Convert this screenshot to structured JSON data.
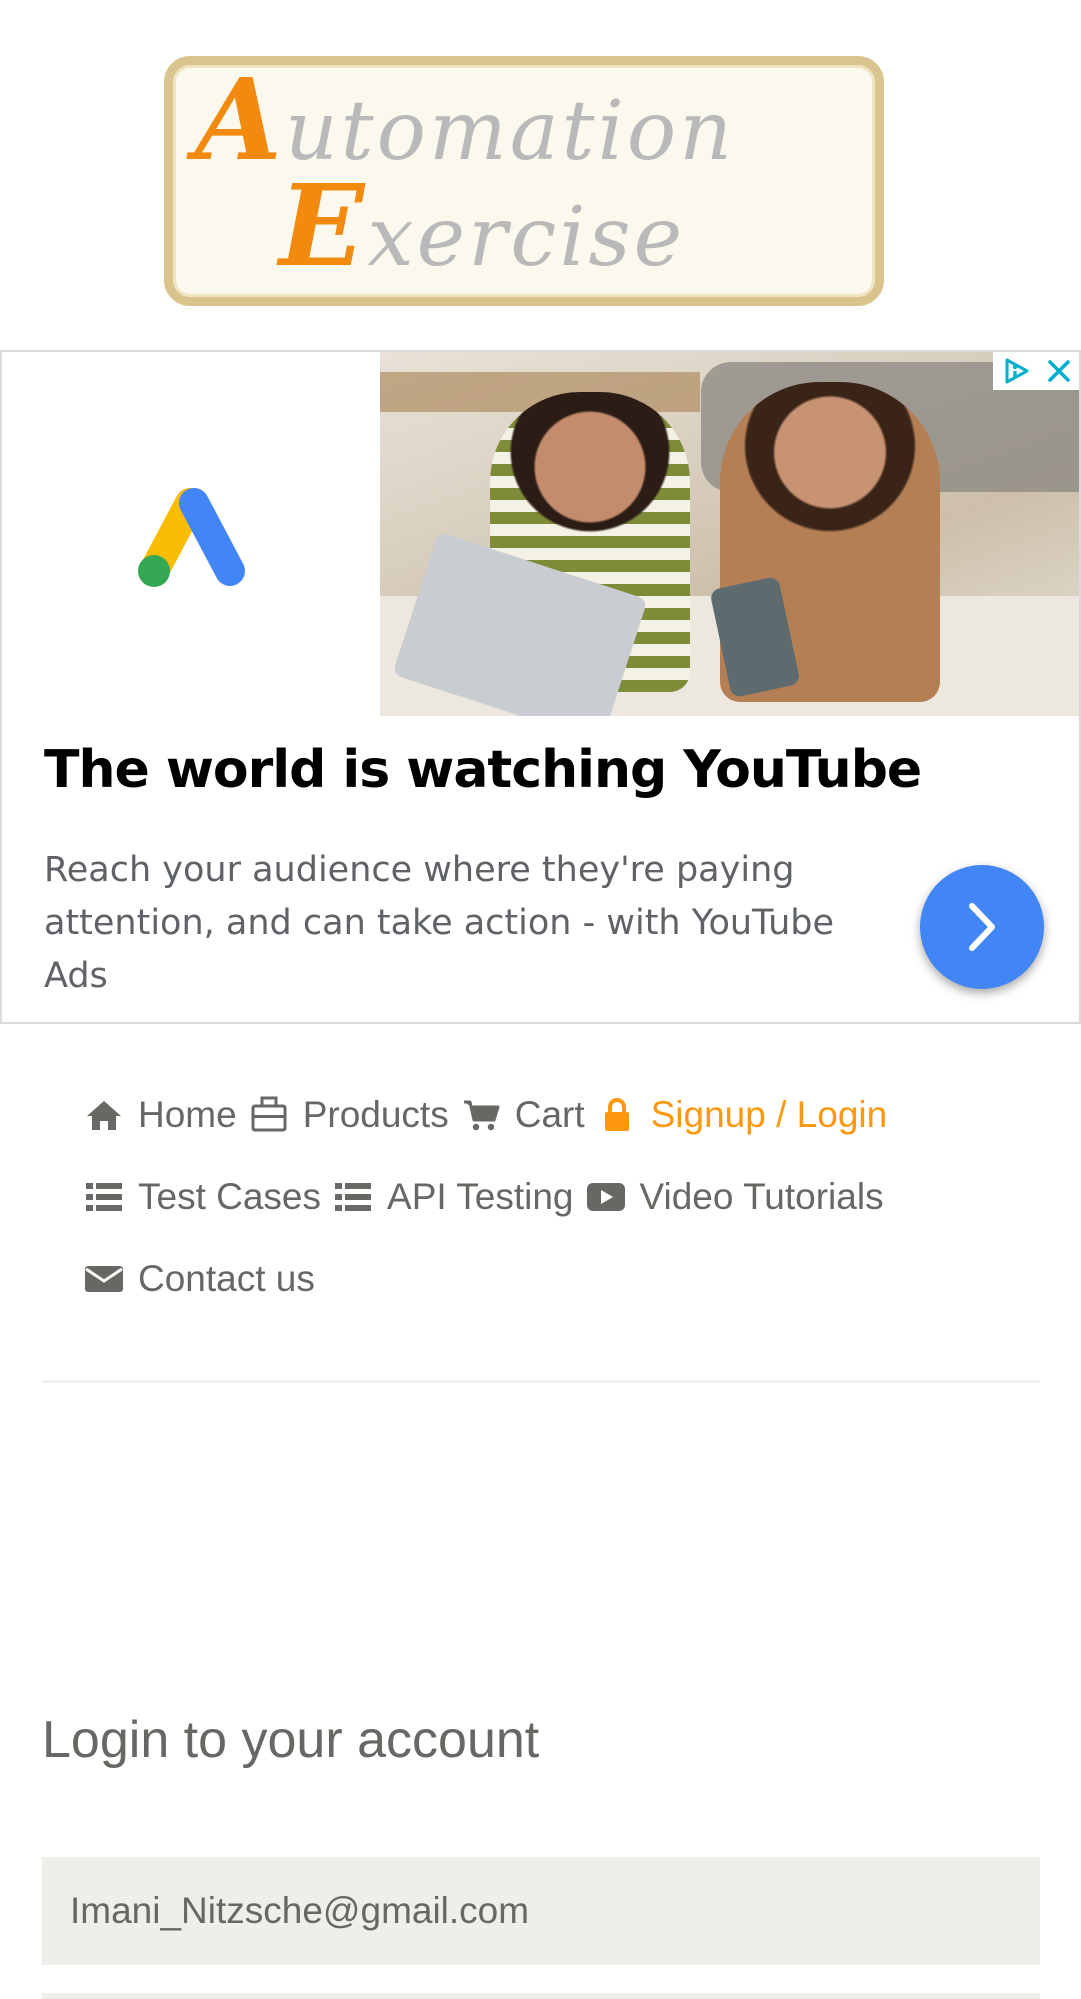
{
  "logo": {
    "line1_cap": "A",
    "line1_rest": "utomation",
    "line2_cap": "E",
    "line2_rest": "xercise",
    "colors": {
      "capital": "#f28a10",
      "letters": "#b9b9b9",
      "border": "#d9c48d"
    }
  },
  "ad": {
    "title": "The world is watching YouTube",
    "description": "Reach your audience where they're paying attention, and can take action - with YouTube Ads",
    "badge_icon": "adchoices-icon",
    "close_icon": "close-icon",
    "brand_icon": "google-ads-icon",
    "cta_icon": "chevron-right-icon",
    "accent": "#4285f4"
  },
  "nav": {
    "row1": [
      {
        "label": "Home",
        "icon": "home-icon"
      },
      {
        "label": "Products",
        "icon": "briefcase-icon"
      },
      {
        "label": "Cart",
        "icon": "shopping-cart-icon"
      },
      {
        "label": "Signup / Login",
        "icon": "lock-icon",
        "active": true
      }
    ],
    "row2": [
      {
        "label": "Test Cases",
        "icon": "list-icon"
      },
      {
        "label": "API Testing",
        "icon": "list-icon"
      },
      {
        "label": "Video Tutorials",
        "icon": "youtube-play-icon"
      }
    ],
    "row3": [
      {
        "label": "Contact us",
        "icon": "envelope-icon"
      }
    ],
    "active_color": "#fe980f"
  },
  "login": {
    "title": "Login to your account",
    "email_value": "Imani_Nitzsche@gmail.com"
  }
}
